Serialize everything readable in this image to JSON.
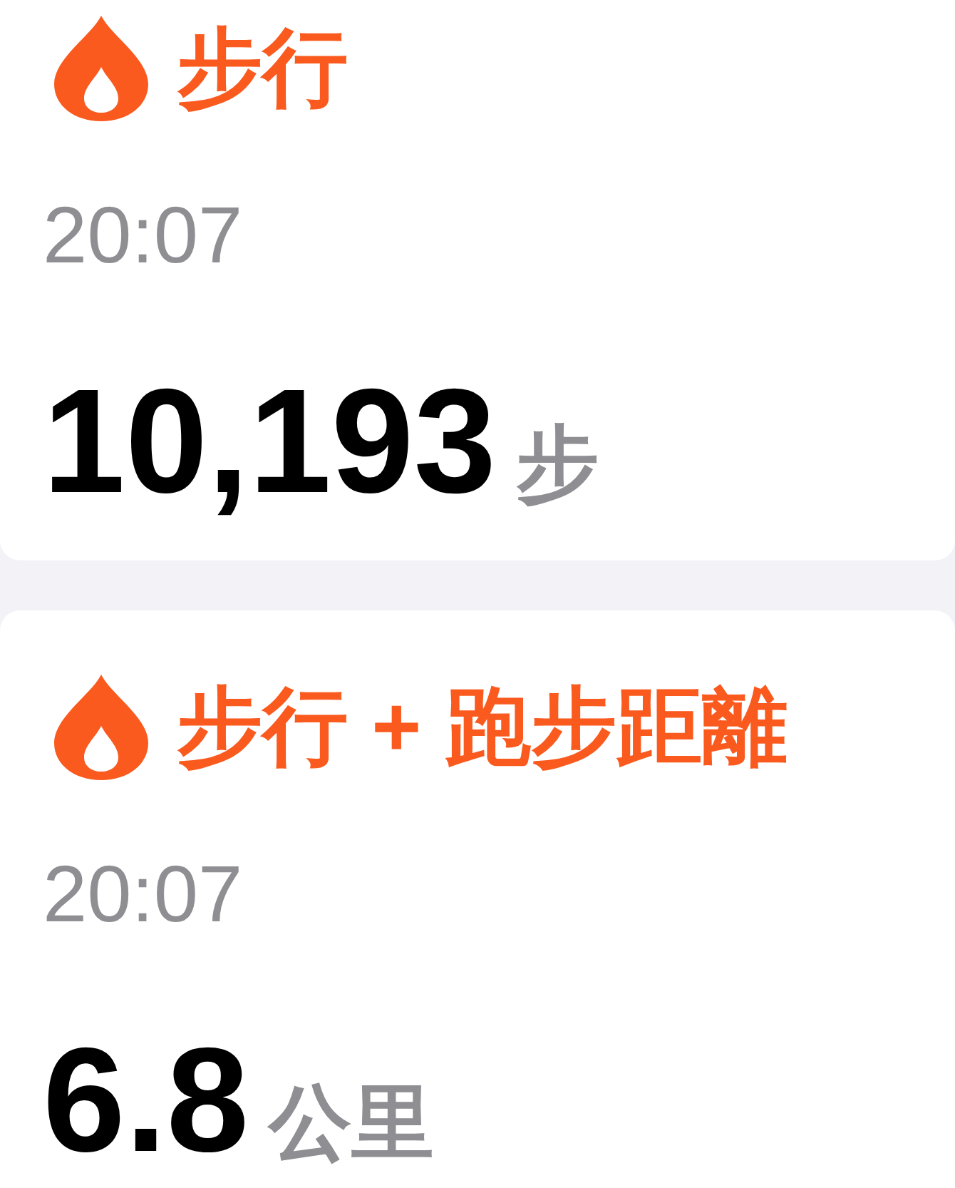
{
  "cards": [
    {
      "title": "步行",
      "time": "20:07",
      "value": "10,193",
      "unit": "步"
    },
    {
      "title": "步行 + 跑步距離",
      "time": "20:07",
      "value": "6.8",
      "unit": "公里"
    }
  ]
}
